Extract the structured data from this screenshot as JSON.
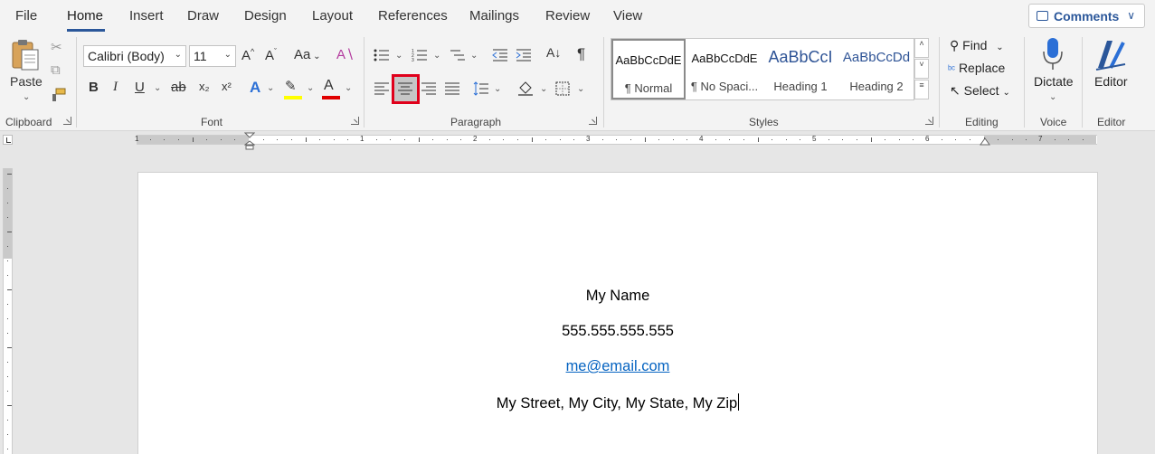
{
  "tabs": [
    "File",
    "Home",
    "Insert",
    "Draw",
    "Design",
    "Layout",
    "References",
    "Mailings",
    "Review",
    "View"
  ],
  "comments_label": "Comments",
  "clipboard": {
    "paste_label": "Paste",
    "group_label": "Clipboard"
  },
  "font": {
    "font_name": "Calibri (Body)",
    "font_size": "11",
    "group_label": "Font",
    "bold": "B",
    "italic": "I",
    "underline": "U",
    "strike": "ab",
    "subscript": "x₂",
    "superscript": "x²",
    "case": "Aa",
    "grow": "A^",
    "shrink": "Aˇ",
    "highlight_color": "#ffff00",
    "font_color": "#e00000"
  },
  "paragraph": {
    "group_label": "Paragraph",
    "active_alignment": "center"
  },
  "styles": {
    "group_label": "Styles",
    "items": [
      {
        "sample": "AaBbCcDdE",
        "name": "¶ Normal"
      },
      {
        "sample": "AaBbCcDdE",
        "name": "¶ No Spaci..."
      },
      {
        "sample": "AaBbCcI",
        "name": "Heading 1"
      },
      {
        "sample": "AaBbCcDd",
        "name": "Heading 2"
      }
    ],
    "heading_color": "#2f5496"
  },
  "editing": {
    "group_label": "Editing",
    "find": "Find",
    "replace": "Replace",
    "select": "Select"
  },
  "voice": {
    "group_label": "Voice",
    "dictate": "Dictate"
  },
  "editor": {
    "group_label": "Editor",
    "label": "Editor"
  },
  "ruler_numbers": [
    "1",
    "1",
    "2",
    "3",
    "4",
    "5",
    "6",
    "7"
  ],
  "document": {
    "name": "My Name",
    "phone": "555.555.555.555",
    "email": "me@email.com",
    "address": "My Street, My City, My State, My Zip"
  },
  "accent_color": "#2b579a",
  "highlight_annotation_color": "#e0001b"
}
